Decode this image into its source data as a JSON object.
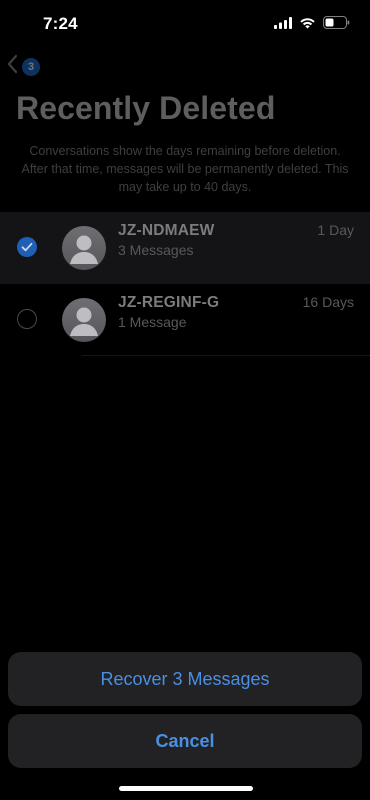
{
  "status_bar": {
    "time": "7:24",
    "icons": [
      "cellular-signal-icon",
      "wifi-icon",
      "battery-icon"
    ]
  },
  "nav": {
    "back_badge_count": "3"
  },
  "page": {
    "title": "Recently Deleted",
    "description": "Conversations show the days remaining before deletion. After that time, messages will be permanently deleted. This may take up to 40 days."
  },
  "conversations": [
    {
      "name": "JZ-NDMAEW",
      "message_count": "3 Messages",
      "days_remaining": "1 Day",
      "selected": true
    },
    {
      "name": "JZ-REGINF-G",
      "message_count": "1 Message",
      "days_remaining": "16 Days",
      "selected": false
    }
  ],
  "actions": {
    "recover_label": "Recover 3 Messages",
    "cancel_label": "Cancel"
  },
  "colors": {
    "accent": "#4a90e2",
    "checkbox_selected": "#1f5fb5",
    "sheet_background": "#222224"
  }
}
